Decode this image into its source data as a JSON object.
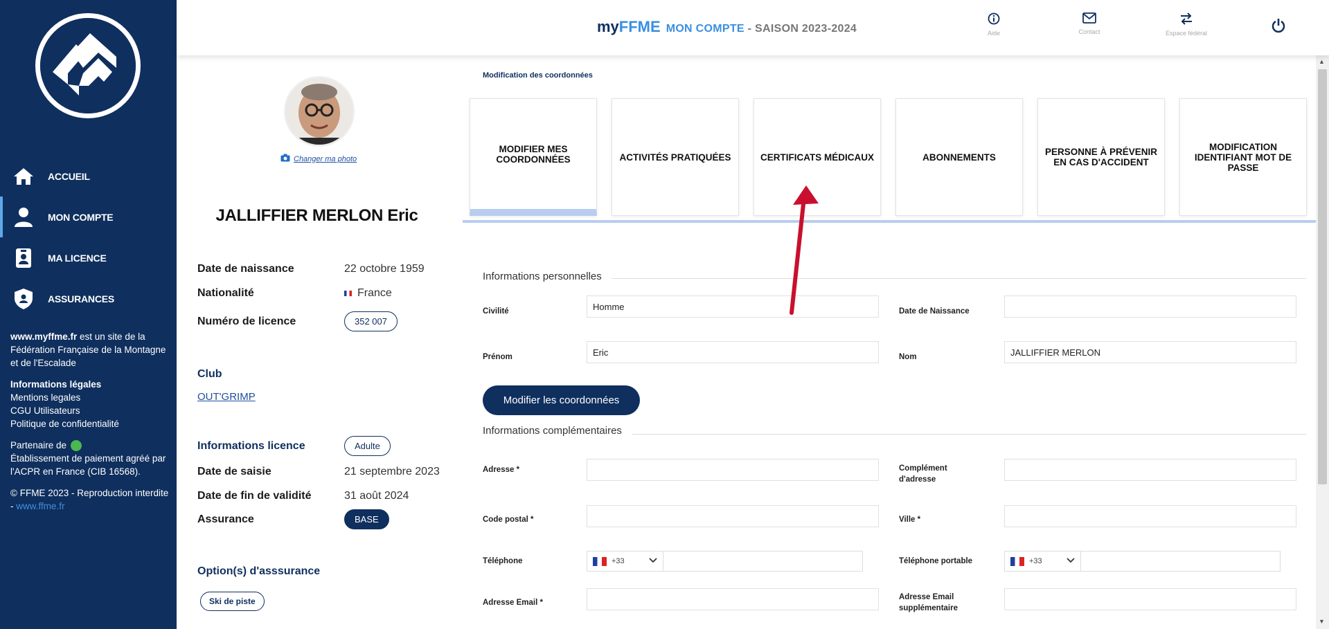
{
  "header": {
    "brand_my": "my",
    "brand_ffme": "FFME",
    "account_label": "MON COMPTE",
    "season": " - SAISON 2023-2024",
    "buttons": [
      {
        "label": "Aide",
        "icon": "info-icon"
      },
      {
        "label": "Contact",
        "icon": "mail-icon"
      },
      {
        "label": "Espace fédéral",
        "icon": "swap-icon"
      }
    ],
    "power_icon": "power-icon"
  },
  "sidebar": {
    "items": [
      {
        "label": "ACCUEIL",
        "icon": "home-icon"
      },
      {
        "label": "MON COMPTE",
        "icon": "user-icon"
      },
      {
        "label": "MA LICENCE",
        "icon": "badge-icon"
      },
      {
        "label": "ASSURANCES",
        "icon": "shield-icon"
      }
    ],
    "site_bold": "www.myffme.fr",
    "site_text": " est un site de la Fédération Française de la Montagne et de l'Escalade",
    "legal_title": "Informations légales",
    "legal_links": [
      "Mentions legales",
      "CGU Utilisateurs",
      "Politique de confidentialité"
    ],
    "partner_text": "Partenaire de",
    "partner_desc": "Établissement de paiement agréé par l'ACPR en France (CIB 16568).",
    "copyright": "© FFME 2023 - Reproduction interdite - ",
    "copyright_link": "www.ffme.fr"
  },
  "profile": {
    "change_photo": "Changer ma photo",
    "name": "JALLIFFIER MERLON Eric",
    "birth_label": "Date de naissance",
    "birth_value": "22 octobre 1959",
    "nationality_label": "Nationalité",
    "nationality_value": "France",
    "license_label": "Numéro de licence",
    "license_value": "352 007",
    "club_title": "Club",
    "club_value": "OUT'GRIMP",
    "license_info_title": "Informations licence",
    "license_type": "Adulte",
    "entry_date_label": "Date de saisie",
    "entry_date_value": "21 septembre 2023",
    "end_date_label": "Date de fin de validité",
    "end_date_value": "31 août 2024",
    "insurance_label": "Assurance",
    "insurance_value": "BASE",
    "options_title": "Option(s) d'asssurance",
    "option_value": "Ski de piste"
  },
  "main": {
    "breadcrumb": "Modification des coordonnées",
    "tabs": [
      "MODIFIER MES COORDONNÉES",
      "ACTIVITÉS PRATIQUÉES",
      "CERTIFICATS MÉDICAUX",
      "ABONNEMENTS",
      "PERSONNE À PRÉVENIR EN CAS D'ACCIDENT",
      "MODIFICATION IDENTIFIANT MOT DE PASSE"
    ],
    "personal": {
      "title": "Informations personnelles",
      "civility_label": "Civilité",
      "civility_value": "Homme",
      "birthdate_label": "Date de Naissance",
      "birthdate_value": "",
      "firstname_label": "Prénom",
      "firstname_value": "Eric",
      "lastname_label": "Nom",
      "lastname_value": "JALLIFFIER MERLON"
    },
    "modify_button": "Modifier les coordonnées",
    "complementary": {
      "title": "Informations complémentaires",
      "address_label": "Adresse *",
      "address_value": "",
      "address2_label": "Complément d'adresse",
      "address2_value": "",
      "postal_label": "Code postal *",
      "postal_value": "",
      "city_label": "Ville *",
      "city_value": "",
      "phone_label": "Téléphone",
      "phone_code": "+33",
      "phone_value": "",
      "mobile_label": "Téléphone portable",
      "mobile_code": "+33",
      "mobile_value": "",
      "email_label": "Adresse Email *",
      "email_value": "",
      "email2_label": "Adresse Email supplémentaire",
      "email2_value": ""
    }
  },
  "colors": {
    "primary": "#0f2f5e",
    "accent": "#3a8fe0",
    "tab_underline": "#b8cdef",
    "arrow": "#c8102e"
  }
}
